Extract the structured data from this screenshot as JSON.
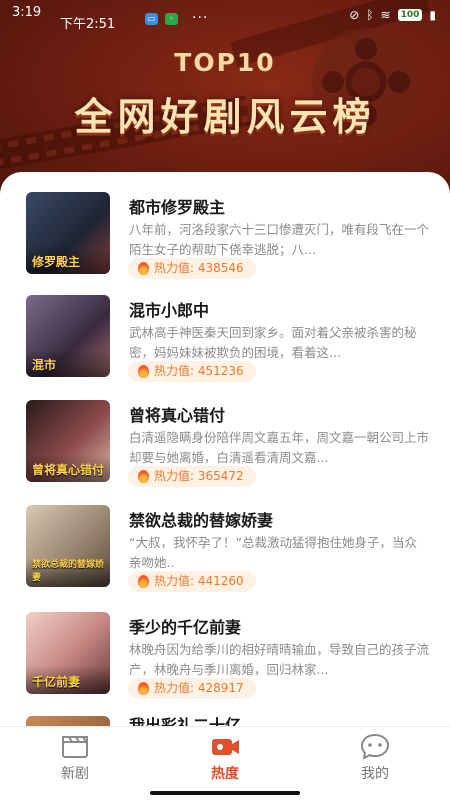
{
  "status": {
    "time": "3:19",
    "sub_time": "下午2:51",
    "battery": "100"
  },
  "header": {
    "title_top": "TOP10",
    "title_main": "全网好剧风云榜"
  },
  "list": [
    {
      "name": "都市修罗殿主",
      "desc": "八年前，河洛段家六十三口惨遭灭门，唯有段飞在一个陌生女子的帮助下侥幸逃脱；八...",
      "heat_label": "热力值:",
      "heat": "438546",
      "cover_text": "修罗殿主",
      "cover_color": "#2d3548"
    },
    {
      "name": "混市小郎中",
      "desc": "武林高手神医秦天回到家乡。面对着父亲被杀害的秘密，妈妈妹妹被欺负的困境，看着这...",
      "heat_label": "热力值:",
      "heat": "451236",
      "cover_text": "混市",
      "cover_color": "#5a4660"
    },
    {
      "name": "曾将真心错付",
      "desc": "白清遥隐瞒身份陪伴周文嘉五年，周文嘉一朝公司上市却要与她离婚，白清遥看清周文嘉...",
      "heat_label": "热力值:",
      "heat": "365472",
      "cover_text": "曾将真心错付",
      "cover_color": "#7a3a3a"
    },
    {
      "name": "禁欲总裁的替嫁娇妻",
      "desc": "“大叔，我怀孕了！”总裁激动猛得抱住她身子，当众亲吻她..",
      "heat_label": "热力值:",
      "heat": "441260",
      "cover_text": "禁欲总裁的替嫁娇妻",
      "cover_color": "#b7a38c"
    },
    {
      "name": "季少的千亿前妻",
      "desc": "林晚舟因为给季川的相好晴晴输血，导致自己的孩子流产，林晚舟与季川离婚，回归林家...",
      "heat_label": "热力值:",
      "heat": "428917",
      "cover_text": "千亿前妻",
      "cover_color": "#c98a86"
    },
    {
      "name": "我出彩礼二十亿",
      "desc": "",
      "heat_label": "",
      "heat": "",
      "cover_text": "",
      "cover_color": "#a0603a"
    }
  ],
  "tabs": [
    {
      "label": "新剧",
      "icon": "clapperboard-icon"
    },
    {
      "label": "热度",
      "icon": "video-camera-icon"
    },
    {
      "label": "我的",
      "icon": "chat-face-icon"
    }
  ],
  "colors": {
    "accent": "#e0502b",
    "heat_bg": "#fff1e4",
    "heat_text": "#f07a2a",
    "header_bg": "#6a1d10"
  }
}
